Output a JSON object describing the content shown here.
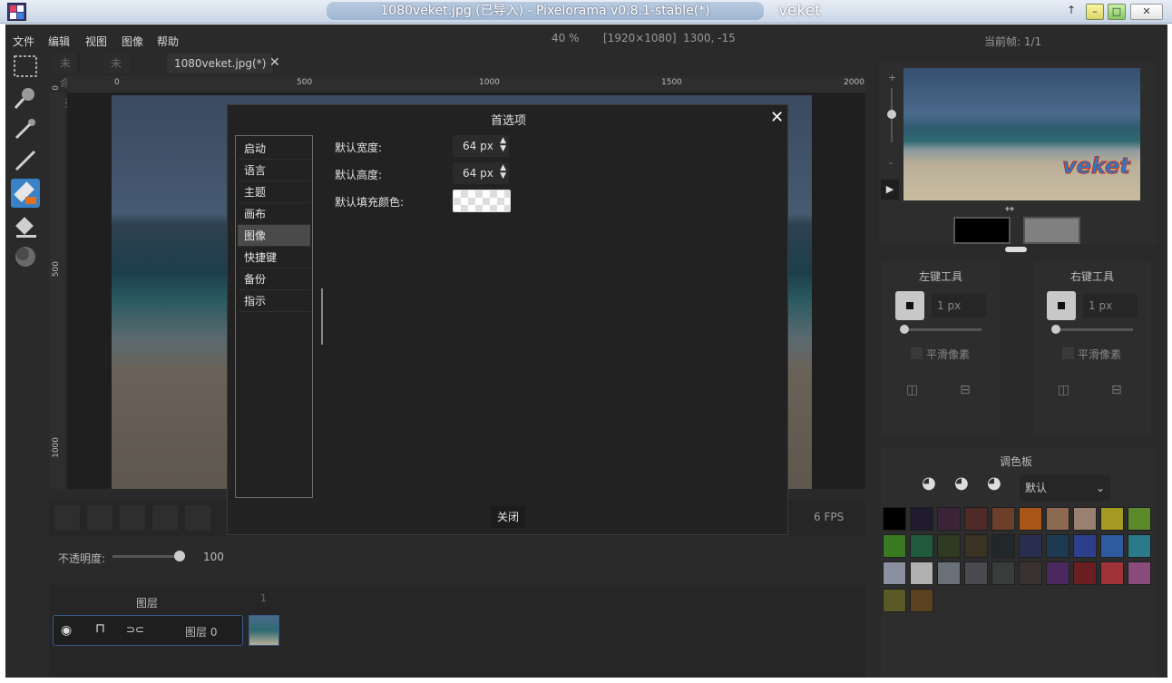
{
  "window": {
    "title": "1080veket.jpg (已导入) - Pixelorama  v0.8.1-stable(*)",
    "user": "veket",
    "btn_pin": "↑",
    "btn_min": "–",
    "btn_max": "□",
    "btn_close": "✕"
  },
  "menu": {
    "items": [
      "文件",
      "编辑",
      "视图",
      "图像",
      "帮助"
    ],
    "zoom": "40 %",
    "dims": "[1920×1080]",
    "coords": "1300, -15",
    "current_frame": "当前帧:  1/1"
  },
  "tabs": [
    "未命名",
    "未命名(*)",
    "1080veket.jpg(*)"
  ],
  "tab_close": "✕",
  "ruler": {
    "h_labels": [
      "0",
      "500",
      "1000",
      "1500",
      "2000"
    ],
    "v_labels": [
      "0",
      "500",
      "1000"
    ]
  },
  "timeline": {
    "fps": "6 FPS",
    "opacity_label": "不透明度:",
    "opacity_value": "100",
    "layers_label": "图层",
    "frame_number": "1",
    "layer_name": "图层 0"
  },
  "tools_panel": {
    "left_title": "左键工具",
    "right_title": "右键工具",
    "left_size": "1 px",
    "right_size": "1 px",
    "pixel_perfect": "平滑像素"
  },
  "preview": {
    "watermark": "veket",
    "zoom_plus": "+",
    "zoom_minus": "-"
  },
  "palette": {
    "title": "调色板",
    "selected": "默认",
    "colors": [
      "#000000",
      "#1f1a2e",
      "#3b2438",
      "#4f2a26",
      "#6b3f2a",
      "#a85516",
      "#8f6a52",
      "#9a8070",
      "#a59a24",
      "#5a8a2a",
      "#3a7a22",
      "#1f5a3a",
      "#2e3a22",
      "#3a3222",
      "#20282a",
      "#2a2e4e",
      "#1e3a52",
      "#2d3f8a",
      "#2e5aa0",
      "#2a7a8a",
      "#8a90a0",
      "#b0b0b0",
      "#6a7078",
      "#4a4a50",
      "#383c3a",
      "#3a3230",
      "#4a2a5e",
      "#6a1e22",
      "#a0323a",
      "#8a4a7a",
      "#5a5a26",
      "#5a4220"
    ]
  },
  "dialog": {
    "title": "首选项",
    "close_x": "✕",
    "categories": [
      "启动",
      "语言",
      "主题",
      "画布",
      "图像",
      "快捷键",
      "备份",
      "指示"
    ],
    "selected_index": 4,
    "width_label": "默认宽度:",
    "width_value": "64 px",
    "height_label": "默认高度:",
    "height_value": "64 px",
    "fill_label": "默认填充颜色:",
    "close_button": "关闭"
  }
}
